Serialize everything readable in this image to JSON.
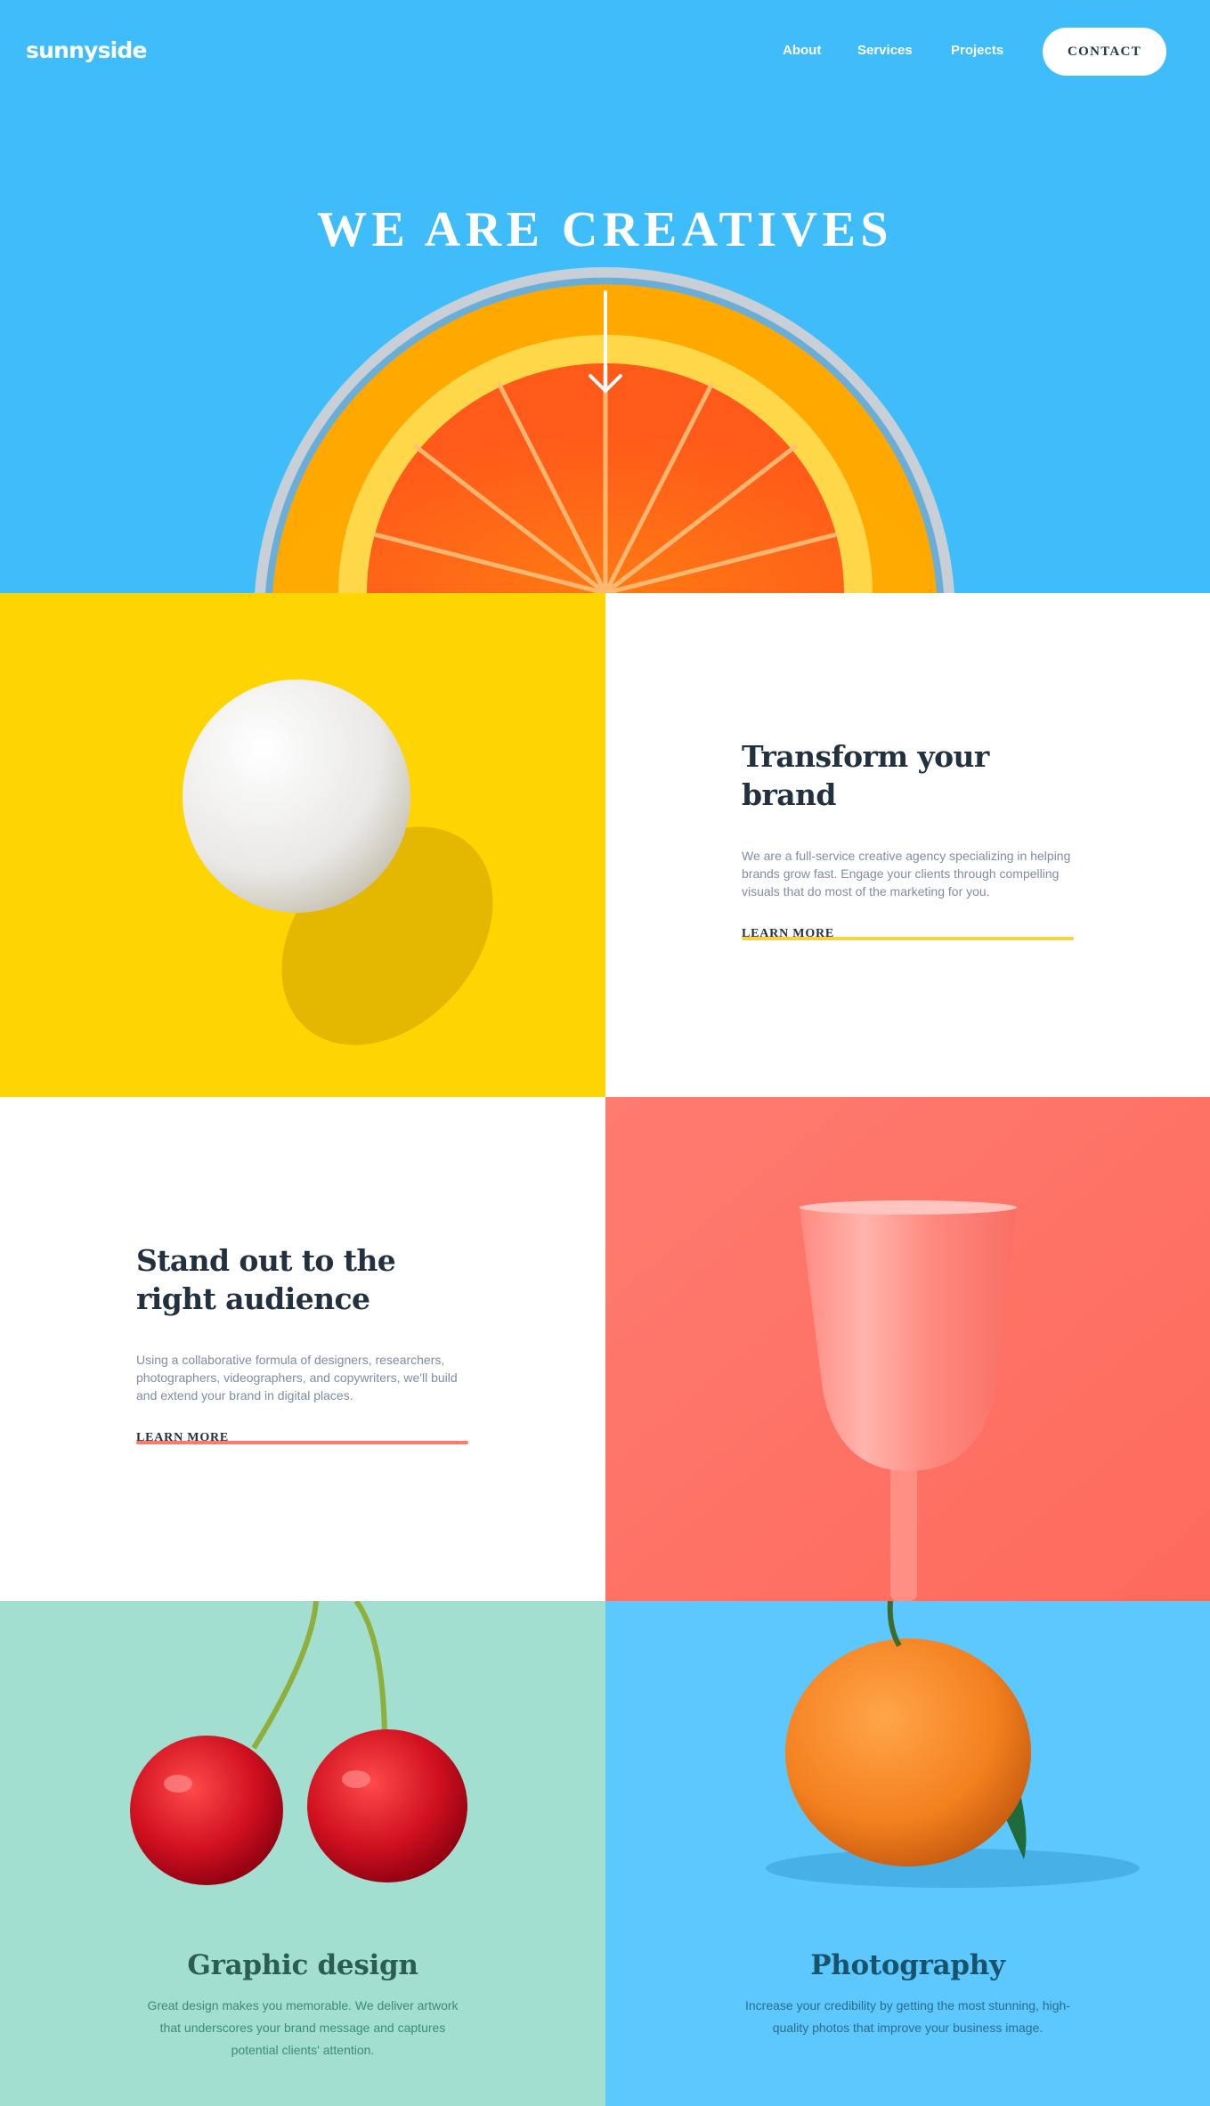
{
  "header": {
    "logo": "sunnyside",
    "nav": [
      "About",
      "Services",
      "Projects"
    ],
    "contact_label": "CONTACT"
  },
  "hero": {
    "title": "WE ARE CREATIVES",
    "arrow_icon": "arrow-down-icon",
    "image": "orange-in-glass",
    "bg_color": "#3fbdfb"
  },
  "features": [
    {
      "title": "Transform your brand",
      "body": "We are a full-service creative agency specializing in helping brands grow fast. Engage your clients through compelling visuals that do most of the marketing for you.",
      "link": "LEARN MORE",
      "underline_color": "#fdd23f",
      "image": "egg",
      "image_bg": "#fed500"
    },
    {
      "title": "Stand out to the right audience",
      "body": "Using a collaborative formula of designers, researchers, photographers, videographers, and copywriters, we'll build and extend your brand in digital places.",
      "link": "LEARN MORE",
      "underline_color": "#fd7a6c",
      "image": "cup",
      "image_bg": "#fe7566"
    }
  ],
  "services": [
    {
      "title": "Graphic design",
      "body": "Great design makes you memorable. We deliver artwork that underscores your brand message and captures potential clients' attention.",
      "image": "cherries",
      "bg": "#a2dfd1"
    },
    {
      "title": "Photography",
      "body": "Increase your credibility by getting the most stunning, high-quality photos that improve your business image.",
      "image": "orange",
      "bg": "#5dc8fe"
    }
  ]
}
